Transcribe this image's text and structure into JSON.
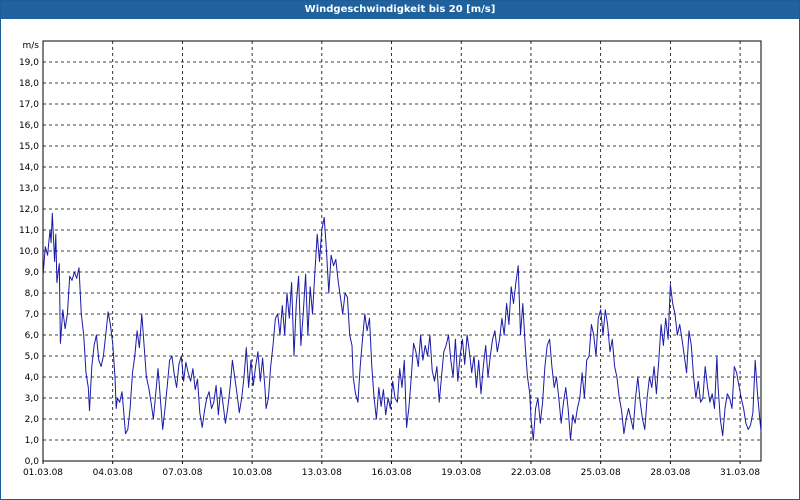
{
  "window": {
    "title": "Windgeschwindigkeit bis 20 [m/s]"
  },
  "colors": {
    "titlebar": "#1f629e",
    "line": "#1a1aa8",
    "grid": "#000000",
    "background": "#ffffff"
  },
  "chart_data": {
    "type": "line",
    "title": "Windgeschwindigkeit bis 20 [m/s]",
    "ylabel": "m/s",
    "xlabel": "",
    "ylim": [
      0,
      20
    ],
    "xlim": [
      0,
      30.9
    ],
    "grid": true,
    "legend": "none",
    "y_ticks": [
      "0,0",
      "1,0",
      "2,0",
      "3,0",
      "4,0",
      "5,0",
      "6,0",
      "7,0",
      "8,0",
      "9,0",
      "10,0",
      "11,0",
      "12,0",
      "13,0",
      "14,0",
      "15,0",
      "16,0",
      "17,0",
      "18,0",
      "19,0"
    ],
    "x_ticks": [
      "01.03.08",
      "04.03.08",
      "07.03.08",
      "10.03.08",
      "13.03.08",
      "16.03.08",
      "19.03.08",
      "22.03.08",
      "25.03.08",
      "28.03.08",
      "31.03.08"
    ],
    "x_tick_days": [
      0,
      3,
      6,
      9,
      12,
      15,
      18,
      21,
      24,
      27,
      30
    ],
    "series": [
      {
        "values": [
          [
            0.0,
            8.8
          ],
          [
            0.1,
            10.2
          ],
          [
            0.2,
            9.8
          ],
          [
            0.3,
            11.0
          ],
          [
            0.35,
            10.4
          ],
          [
            0.4,
            11.8
          ],
          [
            0.5,
            9.5
          ],
          [
            0.55,
            10.8
          ],
          [
            0.6,
            8.5
          ],
          [
            0.7,
            9.4
          ],
          [
            0.75,
            5.6
          ],
          [
            0.85,
            7.2
          ],
          [
            0.95,
            6.3
          ],
          [
            1.05,
            7.0
          ],
          [
            1.15,
            8.8
          ],
          [
            1.25,
            8.6
          ],
          [
            1.35,
            9.0
          ],
          [
            1.45,
            8.7
          ],
          [
            1.55,
            9.2
          ],
          [
            1.65,
            7.0
          ],
          [
            1.75,
            6.0
          ],
          [
            1.85,
            4.2
          ],
          [
            1.95,
            3.5
          ],
          [
            2.0,
            2.4
          ],
          [
            2.1,
            4.5
          ],
          [
            2.2,
            5.5
          ],
          [
            2.3,
            6.0
          ],
          [
            2.4,
            4.8
          ],
          [
            2.5,
            4.5
          ],
          [
            2.6,
            5.0
          ],
          [
            2.7,
            6.0
          ],
          [
            2.8,
            7.1
          ],
          [
            2.9,
            6.5
          ],
          [
            3.0,
            5.6
          ],
          [
            3.1,
            4.0
          ],
          [
            3.15,
            2.5
          ],
          [
            3.2,
            3.0
          ],
          [
            3.3,
            2.8
          ],
          [
            3.4,
            3.3
          ],
          [
            3.5,
            2.0
          ],
          [
            3.55,
            1.3
          ],
          [
            3.65,
            1.5
          ],
          [
            3.75,
            2.5
          ],
          [
            3.85,
            4.2
          ],
          [
            3.95,
            5.0
          ],
          [
            4.05,
            6.2
          ],
          [
            4.15,
            5.4
          ],
          [
            4.25,
            7.0
          ],
          [
            4.35,
            5.5
          ],
          [
            4.45,
            4.0
          ],
          [
            4.55,
            3.5
          ],
          [
            4.65,
            2.8
          ],
          [
            4.75,
            2.0
          ],
          [
            4.85,
            3.2
          ],
          [
            4.95,
            4.4
          ],
          [
            5.05,
            3.0
          ],
          [
            5.15,
            1.5
          ],
          [
            5.25,
            2.5
          ],
          [
            5.35,
            3.6
          ],
          [
            5.45,
            4.8
          ],
          [
            5.55,
            5.0
          ],
          [
            5.65,
            4.1
          ],
          [
            5.75,
            3.5
          ],
          [
            5.85,
            4.6
          ],
          [
            5.95,
            5.0
          ],
          [
            6.05,
            3.8
          ],
          [
            6.15,
            4.7
          ],
          [
            6.25,
            4.2
          ],
          [
            6.35,
            3.8
          ],
          [
            6.45,
            4.4
          ],
          [
            6.55,
            3.4
          ],
          [
            6.65,
            3.9
          ],
          [
            6.75,
            2.3
          ],
          [
            6.85,
            1.6
          ],
          [
            6.95,
            2.4
          ],
          [
            7.05,
            3.0
          ],
          [
            7.15,
            3.3
          ],
          [
            7.25,
            2.5
          ],
          [
            7.35,
            2.8
          ],
          [
            7.45,
            3.6
          ],
          [
            7.55,
            2.2
          ],
          [
            7.65,
            3.5
          ],
          [
            7.75,
            2.7
          ],
          [
            7.85,
            1.8
          ],
          [
            7.95,
            2.5
          ],
          [
            8.05,
            3.5
          ],
          [
            8.15,
            4.8
          ],
          [
            8.25,
            4.0
          ],
          [
            8.35,
            3.2
          ],
          [
            8.45,
            2.3
          ],
          [
            8.55,
            3.0
          ],
          [
            8.65,
            4.0
          ],
          [
            8.75,
            5.4
          ],
          [
            8.85,
            3.5
          ],
          [
            8.95,
            4.8
          ],
          [
            9.05,
            3.6
          ],
          [
            9.15,
            4.5
          ],
          [
            9.25,
            5.2
          ],
          [
            9.35,
            3.8
          ],
          [
            9.45,
            4.9
          ],
          [
            9.55,
            3.5
          ],
          [
            9.6,
            2.5
          ],
          [
            9.7,
            3.0
          ],
          [
            9.8,
            4.5
          ],
          [
            9.9,
            5.5
          ],
          [
            10.0,
            6.8
          ],
          [
            10.1,
            7.0
          ],
          [
            10.2,
            6.0
          ],
          [
            10.3,
            7.4
          ],
          [
            10.4,
            6.0
          ],
          [
            10.5,
            8.0
          ],
          [
            10.6,
            6.8
          ],
          [
            10.7,
            8.5
          ],
          [
            10.8,
            5.0
          ],
          [
            10.9,
            7.5
          ],
          [
            11.0,
            8.8
          ],
          [
            11.1,
            5.5
          ],
          [
            11.2,
            7.0
          ],
          [
            11.3,
            8.9
          ],
          [
            11.4,
            6.0
          ],
          [
            11.5,
            8.3
          ],
          [
            11.6,
            7.0
          ],
          [
            11.7,
            9.0
          ],
          [
            11.8,
            10.8
          ],
          [
            11.9,
            9.5
          ],
          [
            12.0,
            11.0
          ],
          [
            12.1,
            11.6
          ],
          [
            12.2,
            10.0
          ],
          [
            12.3,
            8.0
          ],
          [
            12.4,
            9.8
          ],
          [
            12.5,
            9.3
          ],
          [
            12.6,
            9.6
          ],
          [
            12.7,
            8.6
          ],
          [
            12.8,
            7.8
          ],
          [
            12.9,
            7.0
          ],
          [
            13.0,
            8.0
          ],
          [
            13.1,
            7.8
          ],
          [
            13.2,
            6.0
          ],
          [
            13.3,
            5.5
          ],
          [
            13.35,
            4.0
          ],
          [
            13.45,
            3.2
          ],
          [
            13.55,
            2.8
          ],
          [
            13.65,
            4.5
          ],
          [
            13.75,
            5.8
          ],
          [
            13.85,
            7.0
          ],
          [
            13.95,
            6.2
          ],
          [
            14.05,
            6.8
          ],
          [
            14.15,
            4.5
          ],
          [
            14.25,
            3.0
          ],
          [
            14.35,
            2.0
          ],
          [
            14.45,
            3.5
          ],
          [
            14.55,
            2.6
          ],
          [
            14.65,
            3.4
          ],
          [
            14.75,
            2.2
          ],
          [
            14.85,
            3.0
          ],
          [
            14.95,
            2.5
          ],
          [
            15.05,
            3.8
          ],
          [
            15.15,
            3.0
          ],
          [
            15.25,
            2.8
          ],
          [
            15.35,
            4.4
          ],
          [
            15.45,
            3.5
          ],
          [
            15.55,
            4.8
          ],
          [
            15.65,
            1.6
          ],
          [
            15.75,
            2.6
          ],
          [
            15.85,
            4.0
          ],
          [
            15.95,
            5.6
          ],
          [
            16.05,
            5.2
          ],
          [
            16.15,
            4.5
          ],
          [
            16.25,
            6.0
          ],
          [
            16.35,
            4.8
          ],
          [
            16.45,
            5.5
          ],
          [
            16.55,
            5.0
          ],
          [
            16.65,
            6.0
          ],
          [
            16.75,
            4.3
          ],
          [
            16.85,
            3.8
          ],
          [
            16.95,
            4.5
          ],
          [
            17.05,
            2.8
          ],
          [
            17.15,
            4.0
          ],
          [
            17.25,
            5.2
          ],
          [
            17.35,
            5.5
          ],
          [
            17.45,
            6.0
          ],
          [
            17.55,
            4.8
          ],
          [
            17.65,
            4.0
          ],
          [
            17.75,
            5.8
          ],
          [
            17.85,
            3.8
          ],
          [
            17.95,
            5.0
          ],
          [
            18.05,
            5.8
          ],
          [
            18.15,
            4.6
          ],
          [
            18.25,
            6.0
          ],
          [
            18.35,
            5.2
          ],
          [
            18.45,
            4.2
          ],
          [
            18.55,
            5.0
          ],
          [
            18.65,
            3.5
          ],
          [
            18.75,
            4.8
          ],
          [
            18.85,
            3.2
          ],
          [
            18.95,
            4.5
          ],
          [
            19.05,
            5.5
          ],
          [
            19.15,
            4.0
          ],
          [
            19.25,
            5.0
          ],
          [
            19.35,
            5.8
          ],
          [
            19.45,
            6.2
          ],
          [
            19.55,
            5.2
          ],
          [
            19.65,
            5.8
          ],
          [
            19.75,
            6.8
          ],
          [
            19.85,
            6.0
          ],
          [
            19.95,
            7.5
          ],
          [
            20.05,
            6.5
          ],
          [
            20.15,
            8.3
          ],
          [
            20.25,
            7.5
          ],
          [
            20.35,
            8.5
          ],
          [
            20.45,
            9.3
          ],
          [
            20.55,
            6.0
          ],
          [
            20.65,
            7.5
          ],
          [
            20.75,
            5.5
          ],
          [
            20.85,
            4.0
          ],
          [
            20.95,
            3.2
          ],
          [
            21.0,
            2.0
          ],
          [
            21.1,
            1.0
          ],
          [
            21.2,
            2.5
          ],
          [
            21.3,
            3.0
          ],
          [
            21.4,
            1.8
          ],
          [
            21.5,
            2.8
          ],
          [
            21.6,
            4.5
          ],
          [
            21.7,
            5.5
          ],
          [
            21.8,
            5.8
          ],
          [
            21.9,
            4.5
          ],
          [
            22.0,
            3.5
          ],
          [
            22.1,
            4.0
          ],
          [
            22.2,
            3.0
          ],
          [
            22.3,
            1.8
          ],
          [
            22.4,
            2.8
          ],
          [
            22.5,
            3.5
          ],
          [
            22.6,
            2.5
          ],
          [
            22.7,
            1.0
          ],
          [
            22.8,
            2.2
          ],
          [
            22.9,
            1.8
          ],
          [
            23.0,
            2.5
          ],
          [
            23.1,
            3.0
          ],
          [
            23.2,
            4.2
          ],
          [
            23.3,
            3.0
          ],
          [
            23.4,
            4.8
          ],
          [
            23.5,
            5.0
          ],
          [
            23.6,
            6.5
          ],
          [
            23.7,
            6.0
          ],
          [
            23.8,
            5.0
          ],
          [
            23.9,
            6.8
          ],
          [
            24.0,
            7.2
          ],
          [
            24.1,
            6.0
          ],
          [
            24.2,
            7.2
          ],
          [
            24.3,
            6.5
          ],
          [
            24.4,
            5.2
          ],
          [
            24.5,
            5.8
          ],
          [
            24.6,
            4.5
          ],
          [
            24.7,
            4.0
          ],
          [
            24.8,
            3.0
          ],
          [
            24.9,
            2.4
          ],
          [
            25.0,
            1.3
          ],
          [
            25.1,
            2.0
          ],
          [
            25.2,
            2.5
          ],
          [
            25.3,
            2.0
          ],
          [
            25.4,
            1.5
          ],
          [
            25.5,
            3.0
          ],
          [
            25.6,
            4.0
          ],
          [
            25.7,
            2.8
          ],
          [
            25.8,
            2.0
          ],
          [
            25.9,
            1.5
          ],
          [
            26.0,
            3.0
          ],
          [
            26.1,
            4.0
          ],
          [
            26.2,
            3.5
          ],
          [
            26.3,
            4.5
          ],
          [
            26.4,
            3.2
          ],
          [
            26.5,
            4.8
          ],
          [
            26.6,
            6.5
          ],
          [
            26.7,
            5.5
          ],
          [
            26.8,
            6.8
          ],
          [
            26.9,
            5.8
          ],
          [
            27.0,
            8.4
          ],
          [
            27.1,
            7.5
          ],
          [
            27.2,
            7.0
          ],
          [
            27.3,
            6.0
          ],
          [
            27.4,
            6.5
          ],
          [
            27.5,
            5.8
          ],
          [
            27.6,
            5.0
          ],
          [
            27.7,
            4.2
          ],
          [
            27.8,
            6.2
          ],
          [
            27.9,
            5.5
          ],
          [
            28.0,
            4.0
          ],
          [
            28.1,
            3.0
          ],
          [
            28.2,
            3.8
          ],
          [
            28.3,
            2.8
          ],
          [
            28.4,
            3.0
          ],
          [
            28.5,
            4.5
          ],
          [
            28.6,
            3.5
          ],
          [
            28.7,
            2.8
          ],
          [
            28.8,
            3.2
          ],
          [
            28.9,
            2.5
          ],
          [
            29.0,
            5.0
          ],
          [
            29.05,
            3.6
          ],
          [
            29.15,
            2.0
          ],
          [
            29.25,
            1.2
          ],
          [
            29.35,
            2.5
          ],
          [
            29.45,
            3.2
          ],
          [
            29.55,
            3.0
          ],
          [
            29.65,
            2.5
          ],
          [
            29.75,
            4.5
          ],
          [
            29.85,
            4.2
          ],
          [
            29.95,
            3.6
          ],
          [
            30.05,
            3.0
          ],
          [
            30.15,
            2.5
          ],
          [
            30.25,
            1.8
          ],
          [
            30.35,
            1.5
          ],
          [
            30.45,
            1.7
          ],
          [
            30.55,
            2.3
          ],
          [
            30.65,
            4.8
          ],
          [
            30.75,
            3.2
          ],
          [
            30.85,
            2.0
          ],
          [
            30.9,
            1.4
          ]
        ]
      }
    ]
  }
}
